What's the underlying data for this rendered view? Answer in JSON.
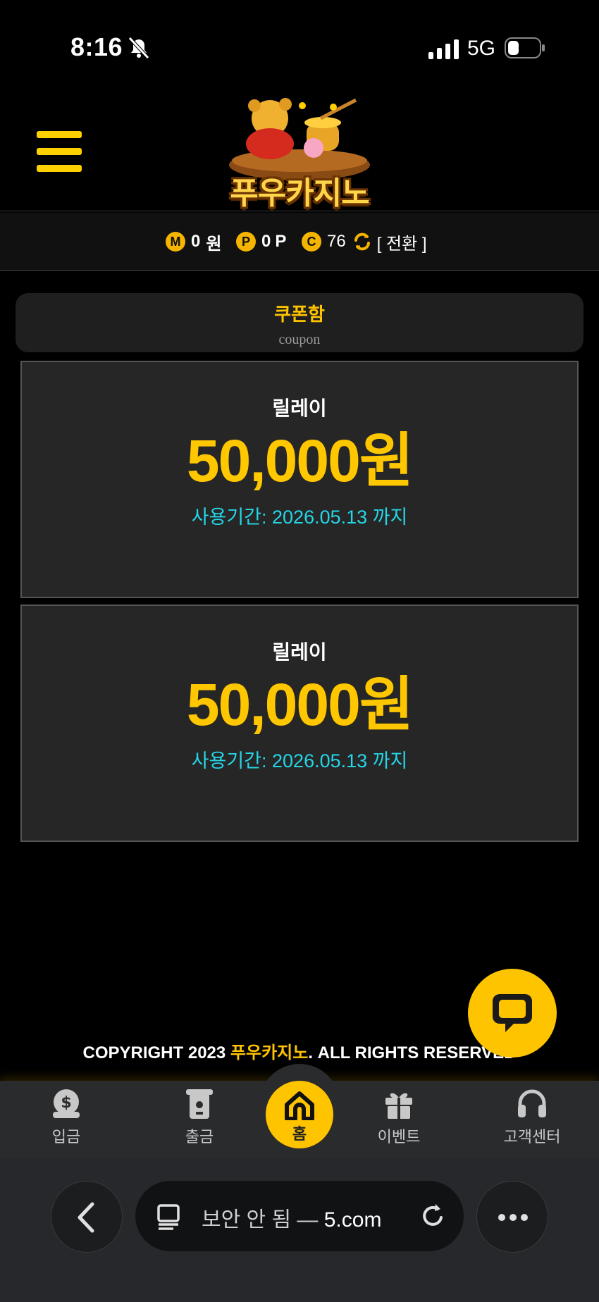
{
  "status_bar": {
    "time": "8:16",
    "network": "5G"
  },
  "header": {
    "logo_text": "푸우카지노"
  },
  "balance": {
    "money_badge": "M",
    "money_value": "0",
    "money_unit": "원",
    "point_badge": "P",
    "point_value": "0",
    "point_unit": "P",
    "coin_badge": "C",
    "coin_value": "76",
    "convert_label": "[ 전환 ]"
  },
  "coupon_tab": {
    "title": "쿠폰함",
    "subtitle": "coupon"
  },
  "coupons": [
    {
      "name": "릴레이",
      "amount": "50,000원",
      "expiry": "사용기간: 2026.05.13 까지"
    },
    {
      "name": "릴레이",
      "amount": "50,000원",
      "expiry": "사용기간: 2026.05.13 까지"
    }
  ],
  "footer": {
    "copyright_prefix": "COPYRIGHT 2023 ",
    "brand": "푸우카지노",
    "copyright_suffix": ". ALL RIGHTS RESERVED"
  },
  "bottom_nav": {
    "deposit": "입금",
    "withdraw": "출금",
    "home": "홈",
    "event": "이벤트",
    "support": "고객센터"
  },
  "browser": {
    "url_label": "보안 안 됨 — ",
    "url_domain": "5.com"
  },
  "colors": {
    "accent": "#ffc400",
    "expiry": "#25d6e6",
    "card_bg": "#262626"
  }
}
